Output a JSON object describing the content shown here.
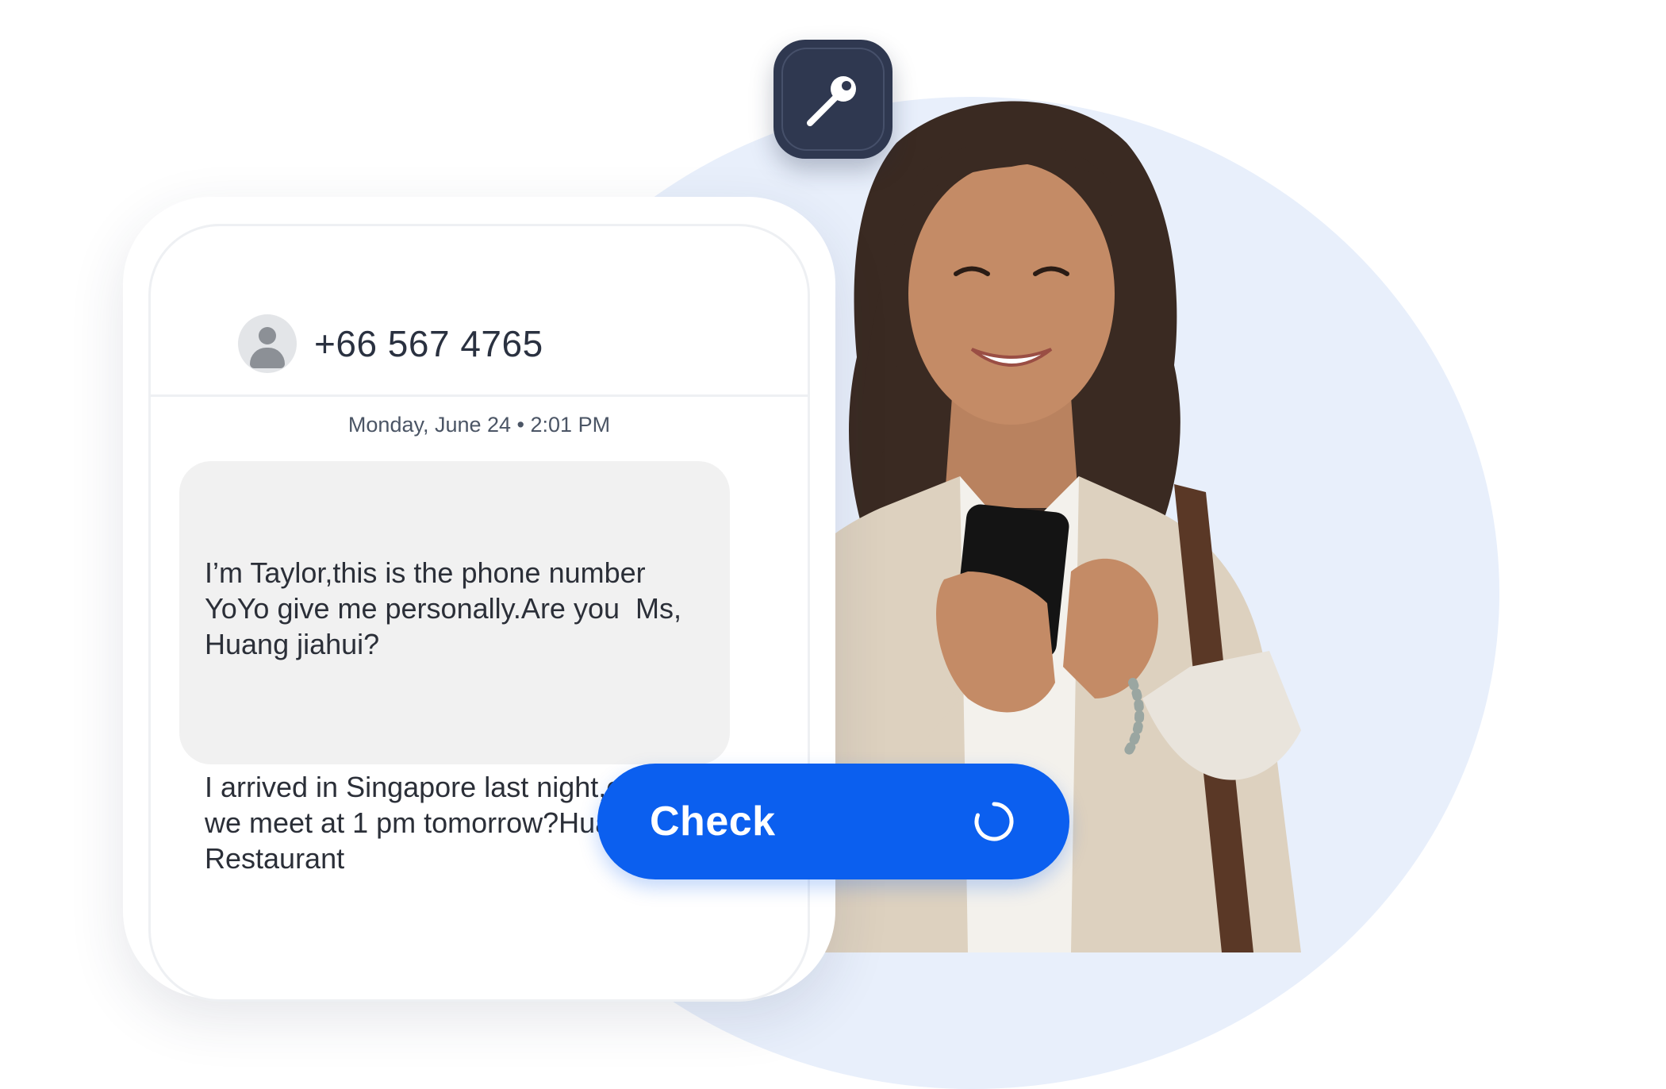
{
  "contact": {
    "number": "+66 567 4765",
    "avatar_icon": "person-silhouette-icon"
  },
  "thread": {
    "timestamp": "Monday, June 24 • 2:01 PM"
  },
  "message": {
    "paragraph_1": "I’m Taylor,this is the phone number\nYoYo give me personally.Are you  Ms,\nHuang jiahui?",
    "paragraph_2": "I arrived in Singapore last night,can\nwe meet at 1 pm tomorrow?Hua Ting\nRestaurant"
  },
  "actions": {
    "check_label": "Check",
    "check_status_icon": "loading-spinner-icon"
  },
  "badge": {
    "icon": "key-icon"
  },
  "colors": {
    "accent": "#0b5fef",
    "tile": "#2f3850",
    "backdrop": "#e8effb",
    "bubble": "#f1f1f1"
  }
}
